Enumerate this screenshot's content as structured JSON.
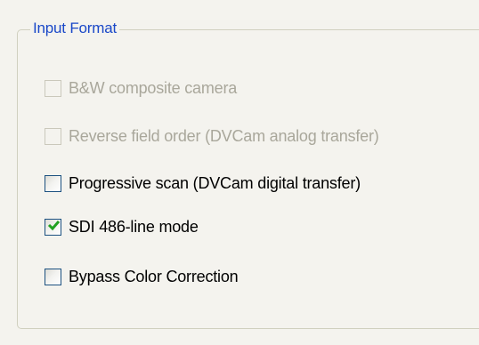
{
  "group": {
    "title": "Input Format"
  },
  "options": [
    {
      "label": "B&W composite camera",
      "checked": false,
      "enabled": false
    },
    {
      "label": "Reverse field order (DVCam analog transfer)",
      "checked": false,
      "enabled": false
    },
    {
      "label": "Progressive scan (DVCam digital transfer)",
      "checked": false,
      "enabled": true
    },
    {
      "label": "SDI 486-line mode",
      "checked": true,
      "enabled": true
    },
    {
      "label": "Bypass Color Correction",
      "checked": false,
      "enabled": true
    }
  ],
  "colors": {
    "group_title": "#1a48c8",
    "disabled_text": "#a9a79b",
    "check_mark": "#21a121"
  }
}
